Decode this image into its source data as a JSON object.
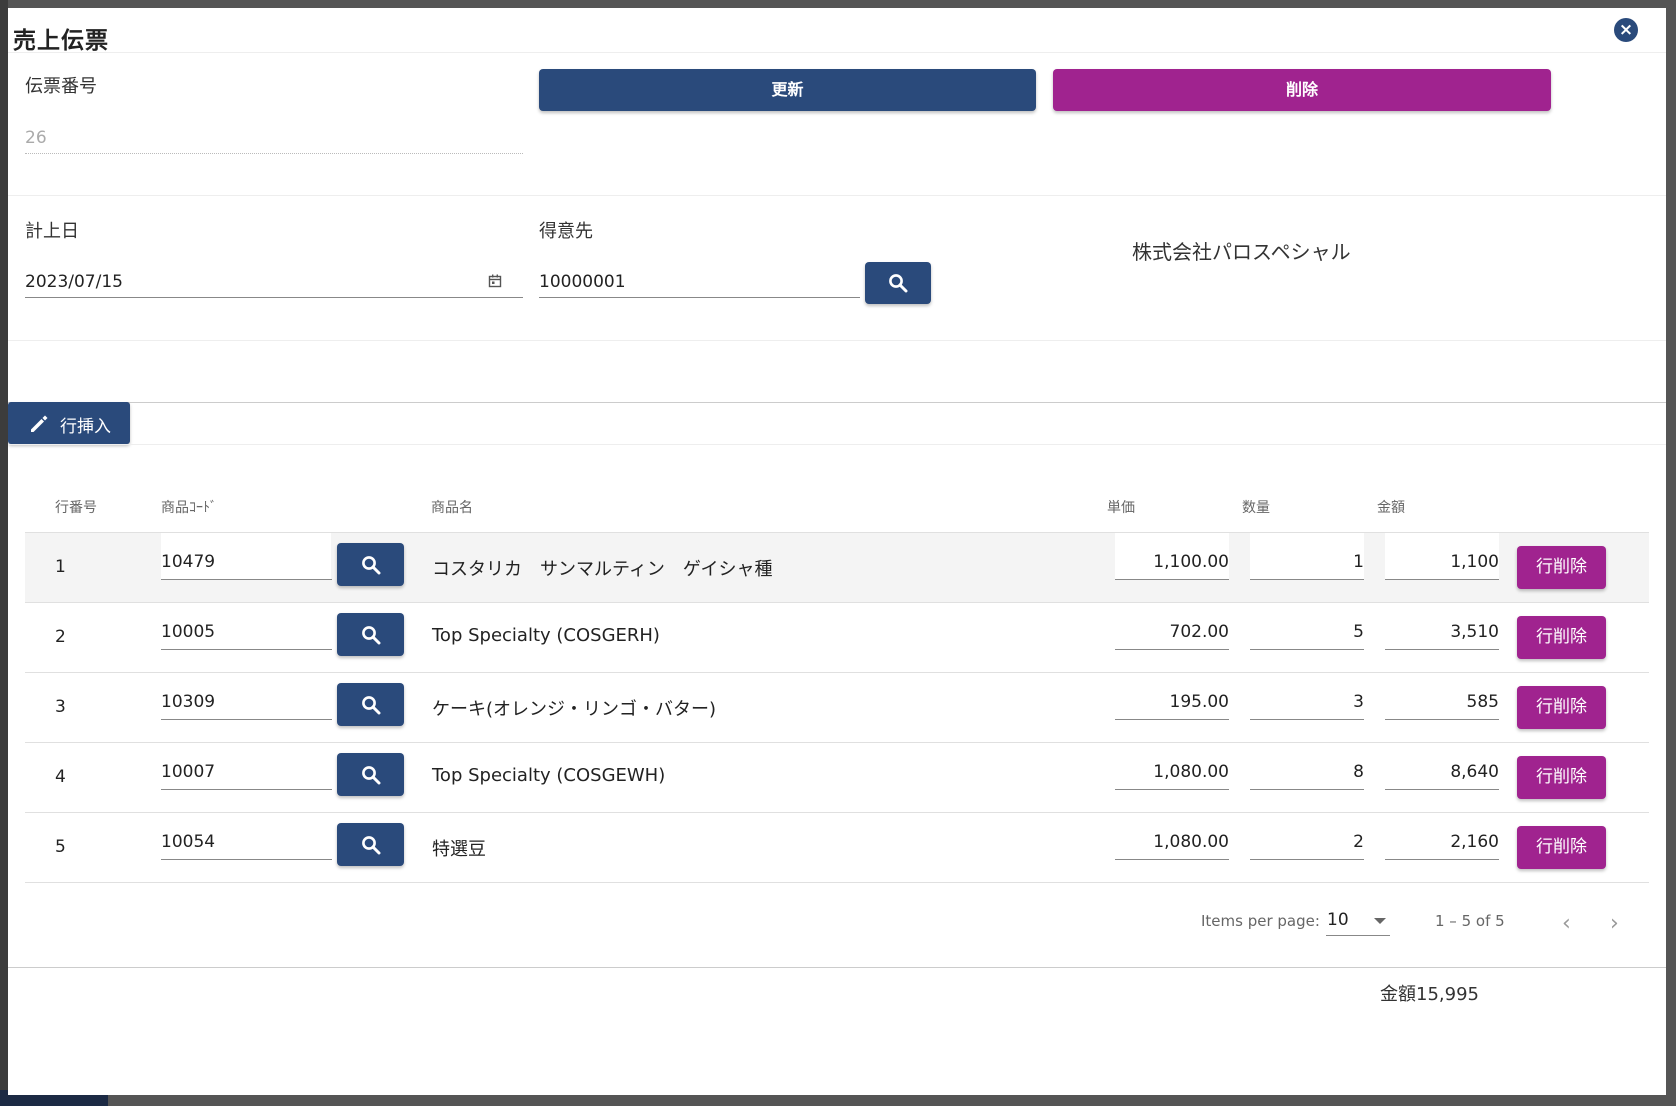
{
  "dialog": {
    "title": "売上伝票",
    "close_icon": "×"
  },
  "header": {
    "slip_number_label": "伝票番号",
    "slip_number_value": "26",
    "update_button": "更新",
    "delete_button": "削除"
  },
  "form": {
    "date_label": "計上日",
    "date_value": "2023/07/15",
    "customer_label": "得意先",
    "customer_code": "10000001",
    "customer_name": "株式会社パロスペシャル"
  },
  "toolbar": {
    "insert_row_button": "行挿入"
  },
  "table": {
    "columns": {
      "row_no": "行番号",
      "product_code": "商品ｺｰﾄﾞ",
      "product_name": "商品名",
      "unit_price": "単価",
      "quantity": "数量",
      "amount": "金額"
    },
    "delete_row_label": "行削除",
    "rows": [
      {
        "no": "1",
        "code": "10479",
        "name": "コスタリカ　サンマルティン　ゲイシャ種",
        "price": "1,100.00",
        "qty": "1",
        "amount": "1,100"
      },
      {
        "no": "2",
        "code": "10005",
        "name": "Top Specialty (COSGERH)",
        "price": "702.00",
        "qty": "5",
        "amount": "3,510"
      },
      {
        "no": "3",
        "code": "10309",
        "name": "ケーキ(オレンジ・リンゴ・バター)",
        "price": "195.00",
        "qty": "3",
        "amount": "585"
      },
      {
        "no": "4",
        "code": "10007",
        "name": "Top Specialty (COSGEWH)",
        "price": "1,080.00",
        "qty": "8",
        "amount": "8,640"
      },
      {
        "no": "5",
        "code": "10054",
        "name": "特選豆",
        "price": "1,080.00",
        "qty": "2",
        "amount": "2,160"
      }
    ]
  },
  "paginator": {
    "items_per_page_label": "Items per page:",
    "items_per_page_value": "10",
    "range_label": "1 – 5 of 5",
    "prev_icon": "‹",
    "next_icon": "›"
  },
  "footer": {
    "total": "金額15,995"
  },
  "colors": {
    "primary": "#2a4a7b",
    "danger": "#a0238f"
  }
}
